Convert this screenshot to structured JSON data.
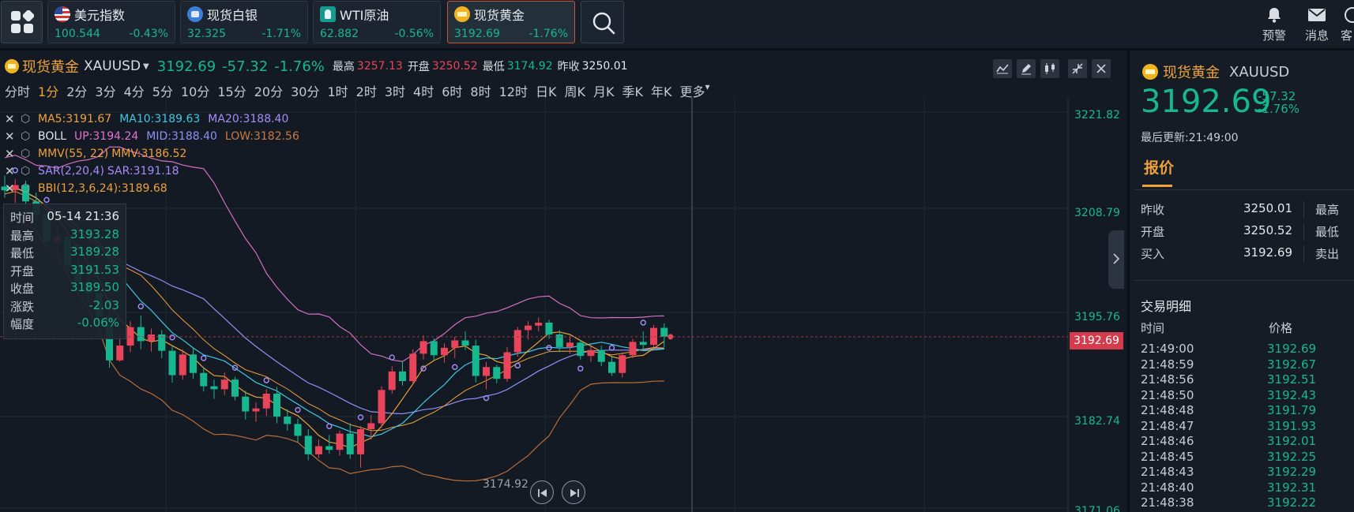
{
  "tickers": [
    {
      "name": "美元指数",
      "price": "100.544",
      "change": "-0.43%",
      "icon": "us-flag-icon"
    },
    {
      "name": "现货白银",
      "price": "32.325",
      "change": "-1.71%",
      "icon": "silver-icon"
    },
    {
      "name": "WTI原油",
      "price": "62.882",
      "change": "-0.56%",
      "icon": "oil-icon"
    },
    {
      "name": "现货黄金",
      "price": "3192.69",
      "change": "-1.76%",
      "icon": "gold-icon"
    }
  ],
  "top_actions": {
    "alert": "预警",
    "message": "消息",
    "third": "客"
  },
  "quote": {
    "name": "现货黄金",
    "code": "XAUUSD",
    "price": "3192.69",
    "change": "-57.32",
    "pct": "-1.76%",
    "high_label": "最高",
    "high": "3257.13",
    "open_label": "开盘",
    "open": "3250.52",
    "low_label": "最低",
    "low": "3174.92",
    "prev_label": "昨收",
    "prev": "3250.01"
  },
  "periods": [
    "分时",
    "1分",
    "2分",
    "3分",
    "4分",
    "5分",
    "10分",
    "15分",
    "20分",
    "30分",
    "1时",
    "2时",
    "3时",
    "4时",
    "6时",
    "8时",
    "12时",
    "日K",
    "周K",
    "月K",
    "季K",
    "年K",
    "更多"
  ],
  "active_period": "1分",
  "indicators": {
    "ma": {
      "ma5": "MA5:3191.67",
      "ma10": "MA10:3189.63",
      "ma20": "MA20:3188.40"
    },
    "boll": {
      "name": "BOLL",
      "up": "UP:3194.24",
      "mid": "MID:3188.40",
      "low": "LOW:3182.56"
    },
    "mmv": {
      "name": "MMV(55, 22)",
      "val": "MMV:3186.52"
    },
    "sar": {
      "name": "SAR(2,20,4)",
      "val": "SAR:3191.18"
    },
    "bbi": {
      "name": "BBI(12,3,6,24):3189.68"
    }
  },
  "tooltip": {
    "time_label": "时间",
    "time": "05-14 21:36",
    "high_label": "最高",
    "high": "3193.28",
    "low_label": "最低",
    "low": "3189.28",
    "open_label": "开盘",
    "open": "3191.53",
    "close_label": "收盘",
    "close": "3189.50",
    "chg_label": "涨跌",
    "chg": "-2.03",
    "amp_label": "幅度",
    "amp": "-0.06%"
  },
  "y_axis": [
    "3221.82",
    "3208.79",
    "3195.76",
    "3182.74",
    "3171.06"
  ],
  "current_price_tag": "3192.69",
  "low_marker": "3174.92",
  "panel": {
    "name": "现货黄金",
    "code": "XAUUSD",
    "price": "3192.69",
    "change": "-57.32",
    "pct": "-1.76%",
    "updated": "最后更新:21:49:00",
    "tab": "报价",
    "rows": [
      {
        "k": "昨收",
        "v": "3250.01",
        "k2": "最高",
        "color": "#e4e7ec"
      },
      {
        "k": "开盘",
        "v": "3250.52",
        "k2": "最低",
        "color": "#e8455a"
      },
      {
        "k": "买入",
        "v": "3192.69",
        "k2": "卖出",
        "color": "#e4e7ec"
      }
    ],
    "trades_title": "交易明细",
    "trades_head": {
      "time": "时间",
      "price": "价格"
    },
    "trades": [
      {
        "t": "21:49:00",
        "p": "3192.69"
      },
      {
        "t": "21:48:59",
        "p": "3192.67"
      },
      {
        "t": "21:48:56",
        "p": "3192.51"
      },
      {
        "t": "21:48:50",
        "p": "3192.43"
      },
      {
        "t": "21:48:48",
        "p": "3191.79"
      },
      {
        "t": "21:48:47",
        "p": "3191.93"
      },
      {
        "t": "21:48:46",
        "p": "3192.01"
      },
      {
        "t": "21:48:45",
        "p": "3192.25"
      },
      {
        "t": "21:48:43",
        "p": "3192.29"
      },
      {
        "t": "21:48:40",
        "p": "3192.31"
      },
      {
        "t": "21:48:38",
        "p": "3192.22"
      }
    ]
  },
  "colors": {
    "up": "#17b890",
    "down": "#e8455a",
    "accent": "#f0a23a"
  },
  "chart_data": {
    "type": "candlestick",
    "ylim": [
      3169,
      3225
    ],
    "candles": [
      [
        3213.0,
        3214.5,
        3211.5,
        3212.5
      ],
      [
        3212.5,
        3214.0,
        3210.8,
        3213.2
      ],
      [
        3213.2,
        3213.8,
        3210.0,
        3211.0
      ],
      [
        3211.0,
        3212.2,
        3208.4,
        3209.2
      ],
      [
        3209.2,
        3210.0,
        3204.5,
        3205.5
      ],
      [
        3205.5,
        3207.8,
        3203.5,
        3206.2
      ],
      [
        3206.2,
        3206.8,
        3201.4,
        3202.3
      ],
      [
        3202.3,
        3203.6,
        3198.5,
        3200.1
      ],
      [
        3200.1,
        3201.5,
        3197.4,
        3198.6
      ],
      [
        3198.6,
        3199.4,
        3194.6,
        3195.4
      ],
      [
        3195.4,
        3196.2,
        3188.5,
        3189.5
      ],
      [
        3189.5,
        3193.3,
        3189.3,
        3191.5
      ],
      [
        3191.5,
        3194.8,
        3190.6,
        3194.0
      ],
      [
        3194.0,
        3195.6,
        3191.0,
        3192.1
      ],
      [
        3192.1,
        3193.8,
        3190.7,
        3193.0
      ],
      [
        3193.0,
        3193.6,
        3189.8,
        3190.8
      ],
      [
        3190.8,
        3191.4,
        3186.5,
        3187.5
      ],
      [
        3187.5,
        3191.0,
        3186.9,
        3190.3
      ],
      [
        3190.3,
        3191.2,
        3187.0,
        3187.8
      ],
      [
        3187.8,
        3188.6,
        3185.3,
        3186.0
      ],
      [
        3186.0,
        3186.9,
        3184.3,
        3185.6
      ],
      [
        3185.6,
        3187.9,
        3184.8,
        3186.9
      ],
      [
        3186.9,
        3187.3,
        3184.1,
        3184.6
      ],
      [
        3184.6,
        3185.4,
        3181.5,
        3182.6
      ],
      [
        3182.6,
        3183.8,
        3181.2,
        3183.0
      ],
      [
        3183.0,
        3185.6,
        3182.0,
        3185.0
      ],
      [
        3185.0,
        3185.9,
        3181.0,
        3181.9
      ],
      [
        3181.9,
        3182.9,
        3180.0,
        3180.9
      ],
      [
        3180.9,
        3181.6,
        3178.5,
        3179.3
      ],
      [
        3179.3,
        3180.2,
        3176.0,
        3176.8
      ],
      [
        3176.8,
        3178.8,
        3176.3,
        3177.9
      ],
      [
        3177.9,
        3179.4,
        3176.9,
        3177.4
      ],
      [
        3177.4,
        3180.0,
        3176.6,
        3179.6
      ],
      [
        3179.6,
        3181.0,
        3176.2,
        3176.8
      ],
      [
        3176.8,
        3180.6,
        3175.0,
        3180.2
      ],
      [
        3180.2,
        3182.1,
        3178.8,
        3181.0
      ],
      [
        3181.0,
        3186.0,
        3180.4,
        3185.5
      ],
      [
        3185.5,
        3188.7,
        3185.0,
        3188.0
      ],
      [
        3188.0,
        3189.4,
        3186.1,
        3186.7
      ],
      [
        3186.7,
        3191.0,
        3186.3,
        3190.4
      ],
      [
        3190.4,
        3192.9,
        3189.6,
        3192.1
      ],
      [
        3192.1,
        3192.5,
        3189.6,
        3190.2
      ],
      [
        3190.2,
        3191.8,
        3189.2,
        3191.2
      ],
      [
        3191.2,
        3192.7,
        3189.8,
        3192.2
      ],
      [
        3192.2,
        3193.4,
        3190.9,
        3191.5
      ],
      [
        3191.5,
        3192.3,
        3186.5,
        3187.4
      ],
      [
        3187.4,
        3189.3,
        3185.6,
        3188.6
      ],
      [
        3188.6,
        3188.9,
        3186.4,
        3187.0
      ],
      [
        3187.0,
        3191.3,
        3186.6,
        3190.6
      ],
      [
        3190.6,
        3194.0,
        3190.0,
        3193.6
      ],
      [
        3193.6,
        3194.8,
        3192.3,
        3194.2
      ],
      [
        3194.2,
        3195.3,
        3193.4,
        3194.6
      ],
      [
        3194.6,
        3195.0,
        3192.4,
        3193.0
      ],
      [
        3193.0,
        3193.6,
        3190.6,
        3191.3
      ],
      [
        3191.3,
        3192.8,
        3190.4,
        3191.9
      ],
      [
        3191.9,
        3192.3,
        3189.6,
        3190.1
      ],
      [
        3190.1,
        3191.4,
        3189.3,
        3190.9
      ],
      [
        3190.9,
        3191.5,
        3188.7,
        3189.3
      ],
      [
        3189.3,
        3190.0,
        3187.4,
        3187.8
      ],
      [
        3187.8,
        3190.6,
        3187.2,
        3190.2
      ],
      [
        3190.2,
        3192.4,
        3189.8,
        3192.0
      ],
      [
        3192.0,
        3193.4,
        3191.0,
        3191.6
      ],
      [
        3191.6,
        3194.3,
        3191.2,
        3193.9
      ],
      [
        3193.9,
        3194.5,
        3191.3,
        3192.7
      ]
    ]
  }
}
